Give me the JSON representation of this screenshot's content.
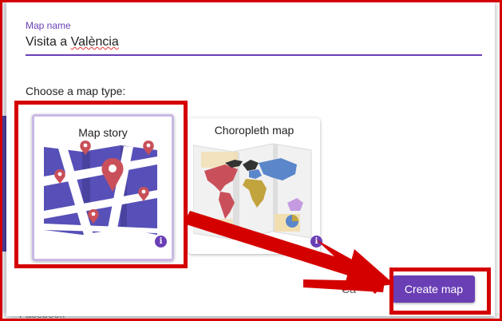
{
  "background": {
    "sidebar_text": "Facebook"
  },
  "dialog": {
    "field": {
      "label": "Map name",
      "value_prefix": "Visita a ",
      "value_misspelled": "València"
    },
    "choose_label": "Choose a map type:",
    "cards": [
      {
        "title": "Map story",
        "info": "i",
        "selected": true
      },
      {
        "title": "Choropleth map",
        "info": "i",
        "selected": false
      }
    ],
    "buttons": {
      "cancel": "Ca",
      "create": "Create map"
    }
  },
  "colors": {
    "accent": "#6a3fb5",
    "annotation": "#d40000",
    "pin": "#c9505a"
  }
}
